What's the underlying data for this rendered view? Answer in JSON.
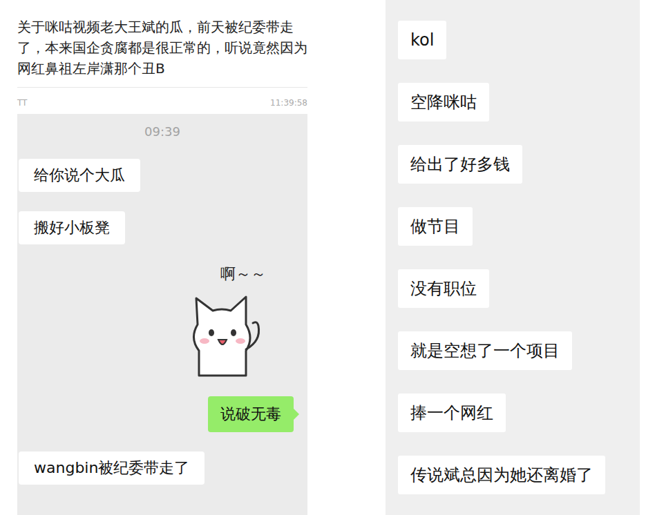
{
  "post": {
    "text": "关于咪咕视频老大王斌的瓜，前天被纪委带走了，本来国企贪腐都是很正常的，听说竟然因为网红鼻祖左岸潇那个丑B"
  },
  "chat_header": {
    "name": "TT",
    "time": "11:39:58"
  },
  "left_chat": {
    "timestamp": "09:39",
    "messages": [
      {
        "kind": "received",
        "text": "给你说个大瓜"
      },
      {
        "kind": "received",
        "text": "搬好小板凳"
      },
      {
        "kind": "sticker",
        "text": "啊～～"
      },
      {
        "kind": "sent",
        "text": "说破无毒"
      },
      {
        "kind": "received",
        "text": "wangbin被纪委带走了"
      }
    ]
  },
  "right_chat": {
    "messages": [
      {
        "text": "kol"
      },
      {
        "text": "空降咪咕"
      },
      {
        "text": "给出了好多钱"
      },
      {
        "text": "做节目"
      },
      {
        "text": "没有职位"
      },
      {
        "text": "就是空想了一个项目"
      },
      {
        "text": "捧一个网红"
      },
      {
        "text": "传说斌总因为她还离婚了"
      }
    ]
  }
}
